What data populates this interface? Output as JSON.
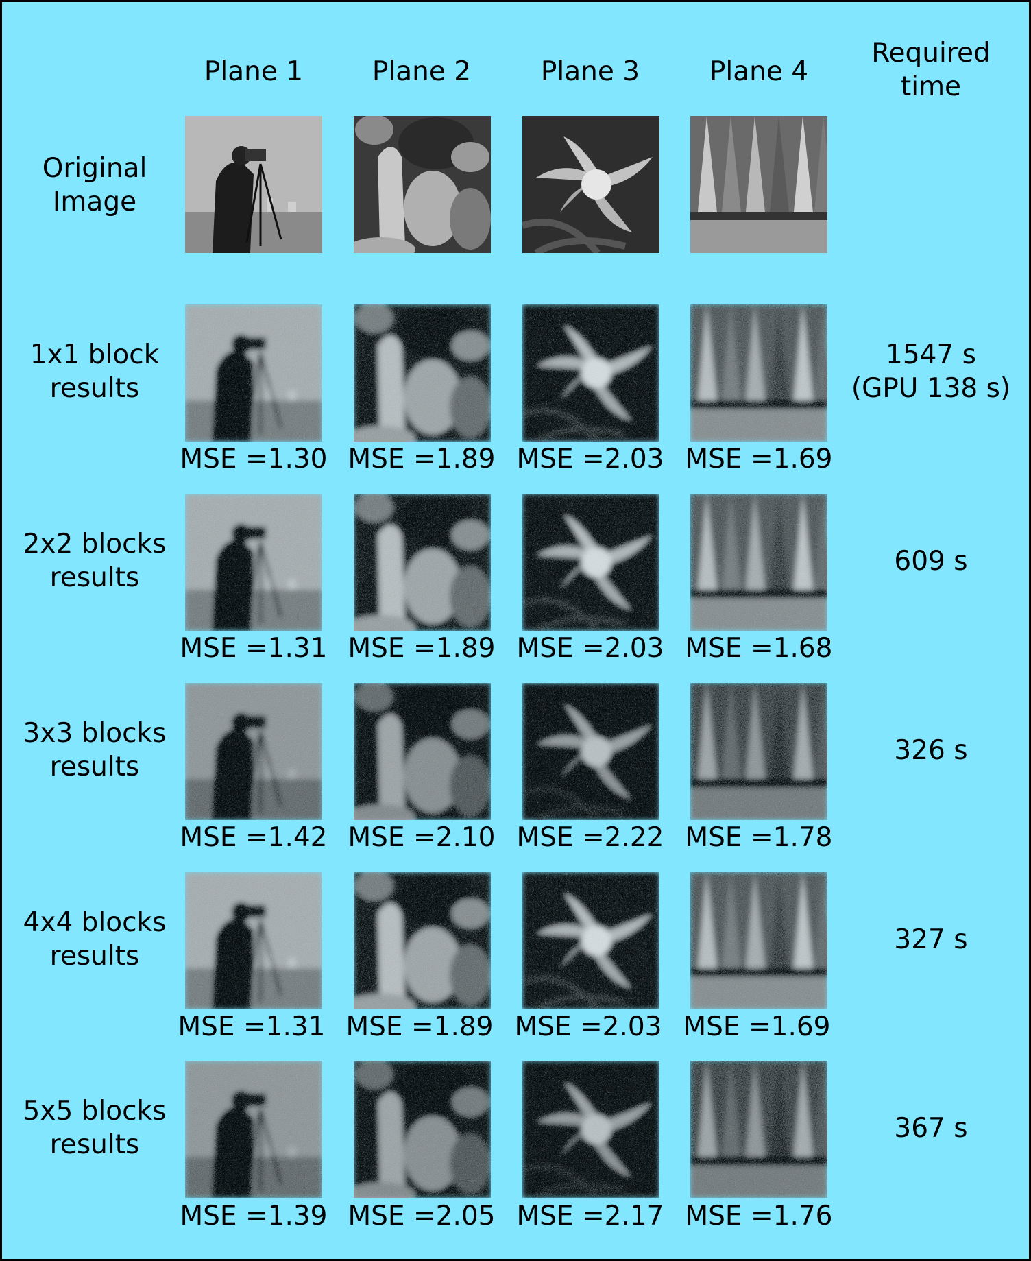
{
  "columns": [
    "Plane 1",
    "Plane 2",
    "Plane 3",
    "Plane 4"
  ],
  "time_header": "Required\ntime",
  "rows": [
    {
      "label": "Original\nImage",
      "time": "",
      "mse": [],
      "images": [
        "cameraman-original",
        "peppers-original",
        "flower-original",
        "sailboats-original"
      ]
    },
    {
      "label": "1x1 block\nresults",
      "time": "1547 s\n(GPU 138 s)",
      "mse": [
        "MSE =1.30",
        "MSE =1.89",
        "MSE =2.03",
        "MSE =1.69"
      ],
      "images": [
        "cameraman-1x1",
        "peppers-1x1",
        "flower-1x1",
        "sailboats-1x1"
      ]
    },
    {
      "label": "2x2 blocks\nresults",
      "time": "609 s",
      "mse": [
        "MSE =1.31",
        "MSE =1.89",
        "MSE =2.03",
        "MSE =1.68"
      ],
      "images": [
        "cameraman-2x2",
        "peppers-2x2",
        "flower-2x2",
        "sailboats-2x2"
      ]
    },
    {
      "label": "3x3 blocks\nresults",
      "time": "326 s",
      "mse": [
        "MSE =1.42",
        "MSE =2.10",
        "MSE =2.22",
        "MSE =1.78"
      ],
      "images": [
        "cameraman-3x3",
        "peppers-3x3",
        "flower-3x3",
        "sailboats-3x3"
      ]
    },
    {
      "label": "4x4 blocks\nresults",
      "time": "327 s",
      "mse": [
        "MSE =1.31",
        "MSE =1.89",
        "MSE =2.03",
        "MSE =1.69"
      ],
      "images": [
        "cameraman-4x4",
        "peppers-4x4",
        "flower-4x4",
        "sailboats-4x4"
      ]
    },
    {
      "label": "5x5 blocks\nresults",
      "time": "367 s",
      "mse": [
        "MSE =1.39",
        "MSE =2.05",
        "MSE =2.17",
        "MSE =1.76"
      ],
      "images": [
        "cameraman-5x5",
        "peppers-5x5",
        "flower-5x5",
        "sailboats-5x5"
      ]
    }
  ],
  "colors": {
    "background": "#82e6ff",
    "border": "#000000",
    "text": "#000000"
  }
}
